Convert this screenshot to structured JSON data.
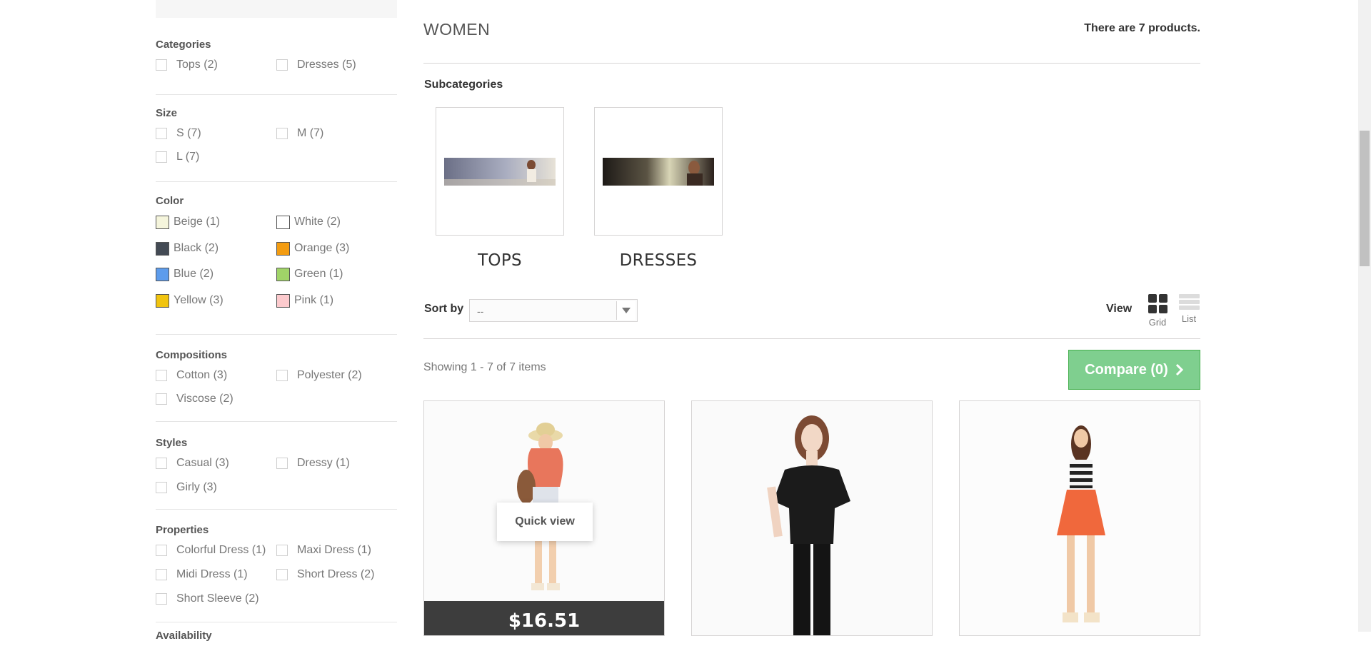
{
  "sidebar": {
    "categories": {
      "title": "Categories",
      "items": [
        {
          "label": "Tops (2)"
        },
        {
          "label": "Dresses (5)"
        }
      ]
    },
    "size": {
      "title": "Size",
      "items": [
        {
          "label": "S (7)"
        },
        {
          "label": "M (7)"
        },
        {
          "label": "L (7)"
        }
      ]
    },
    "color": {
      "title": "Color",
      "items": [
        {
          "label": "Beige (1)",
          "swatch": "#f5f5dc"
        },
        {
          "label": "White (2)",
          "swatch": "#ffffff"
        },
        {
          "label": "Black (2)",
          "swatch": "#434a54"
        },
        {
          "label": "Orange (3)",
          "swatch": "#f39c11"
        },
        {
          "label": "Blue (2)",
          "swatch": "#5d9cec"
        },
        {
          "label": "Green (1)",
          "swatch": "#a0d468"
        },
        {
          "label": "Yellow (3)",
          "swatch": "#f1c40f"
        },
        {
          "label": "Pink (1)",
          "swatch": "#fccacd"
        }
      ]
    },
    "compositions": {
      "title": "Compositions",
      "items": [
        {
          "label": "Cotton (3)"
        },
        {
          "label": "Polyester (2)"
        },
        {
          "label": "Viscose (2)"
        }
      ]
    },
    "styles": {
      "title": "Styles",
      "items": [
        {
          "label": "Casual (3)"
        },
        {
          "label": "Dressy (1)"
        },
        {
          "label": "Girly (3)"
        }
      ]
    },
    "properties": {
      "title": "Properties",
      "items": [
        {
          "label": "Colorful Dress (1)"
        },
        {
          "label": "Maxi Dress (1)"
        },
        {
          "label": "Midi Dress (1)"
        },
        {
          "label": "Short Dress (2)"
        },
        {
          "label": "Short Sleeve (2)"
        }
      ]
    },
    "availability": {
      "title": "Availability"
    }
  },
  "main": {
    "title": "WOMEN",
    "product_count": "There are 7 products.",
    "subcategories_heading": "Subcategories",
    "subcategories": [
      {
        "name": "TOPS"
      },
      {
        "name": "DRESSES"
      }
    ],
    "sort_label": "Sort by",
    "sort_value": "--",
    "view_label": "View",
    "view_grid": "Grid",
    "view_list": "List",
    "showing": "Showing 1 - 7 of 7 items",
    "compare_label": "Compare (0)",
    "quick_view": "Quick view",
    "products": [
      {
        "price": "$16.51"
      },
      {
        "price": ""
      },
      {
        "price": ""
      }
    ]
  },
  "colors": {
    "compare_bg": "#7fcf8f",
    "price_bar": "#3d3d3d",
    "border": "#d6d4d4"
  },
  "icons": {
    "sort_arrow": "chevron-down-icon",
    "compare_arrow": "chevron-right-icon",
    "grid": "grid-view-icon",
    "list": "list-view-icon"
  }
}
